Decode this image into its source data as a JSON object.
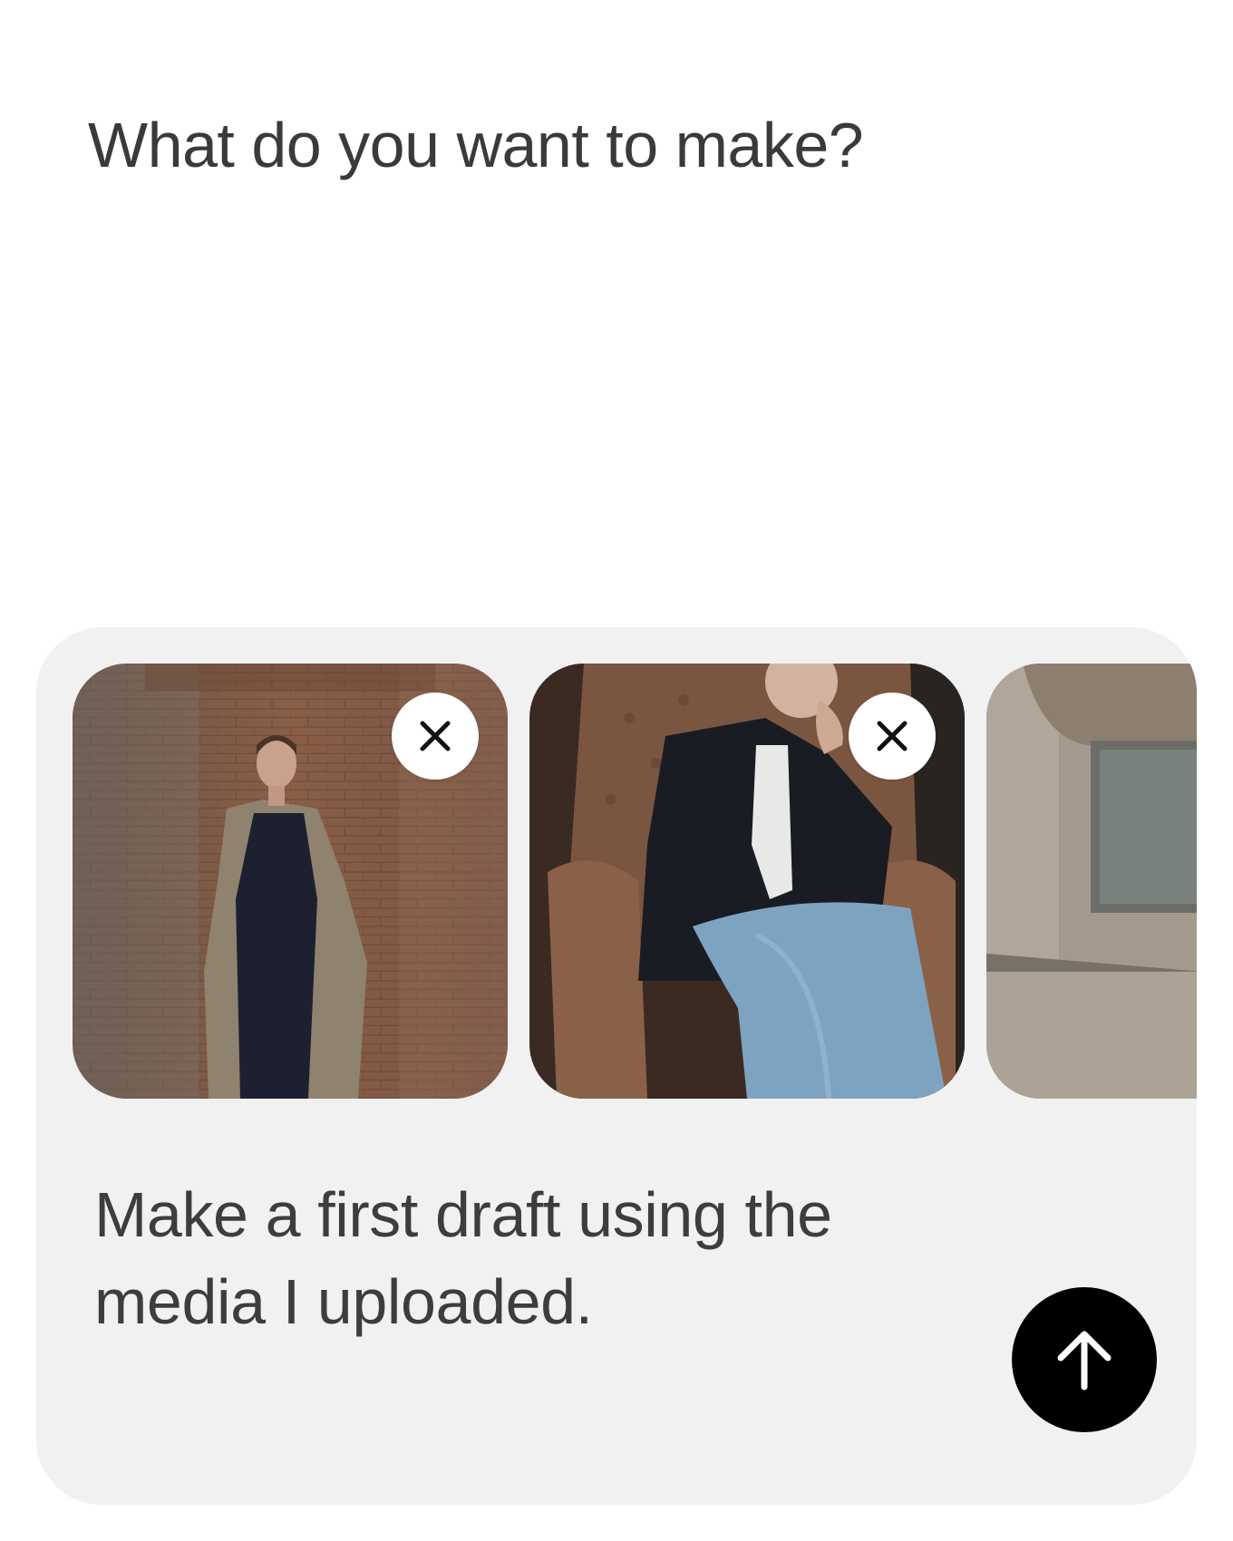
{
  "heading": "What do you want to make?",
  "composer": {
    "prompt_text": "Make a first draft using the media I uploaded.",
    "media": [
      {
        "name": "media-thumbnail-1",
        "icon": "close-icon"
      },
      {
        "name": "media-thumbnail-2",
        "icon": "close-icon"
      },
      {
        "name": "media-thumbnail-3"
      }
    ],
    "send_icon": "arrow-up-icon"
  },
  "colors": {
    "composer_bg": "#f1f1f1",
    "send_button": "#000000",
    "text": "#3d3d3d"
  }
}
